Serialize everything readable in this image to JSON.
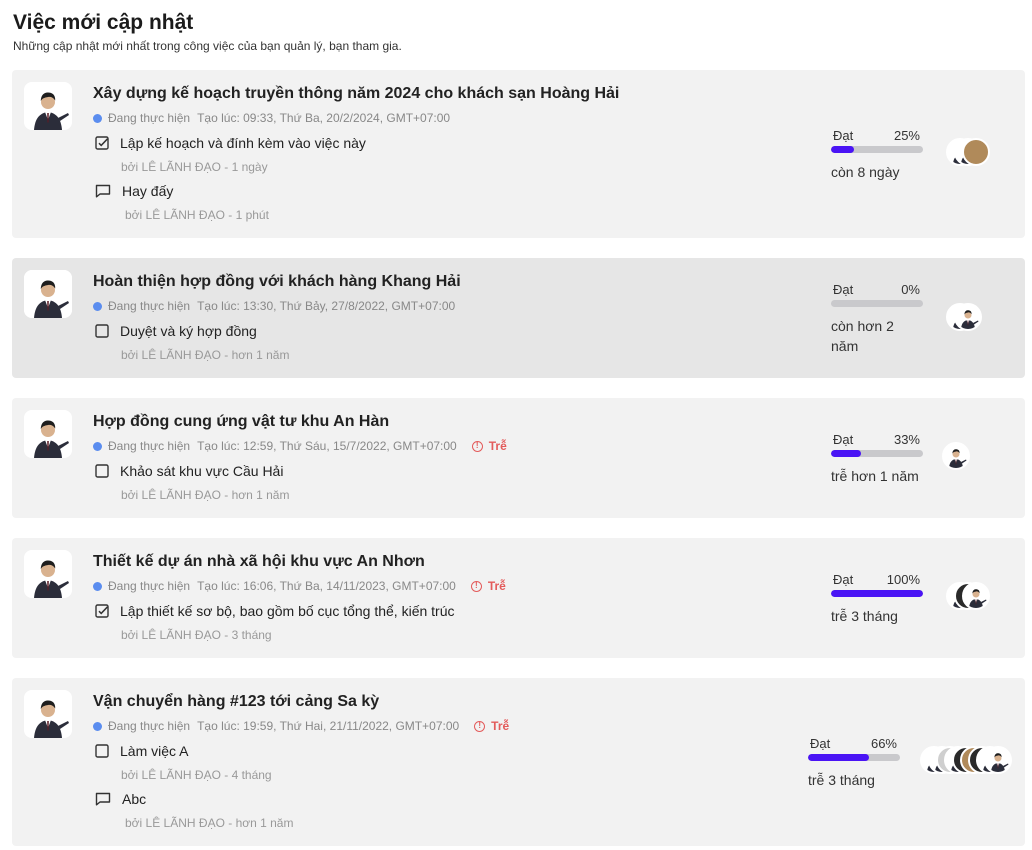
{
  "header": {
    "title": "Việc mới cập nhật",
    "subtitle": "Những cập nhật mới nhất trong công việc của bạn quản lý, bạn tham gia."
  },
  "colors": {
    "progress_fill": "#4a14f5",
    "status_dot": "#5b8def",
    "late": "#e35b5b"
  },
  "tasks": [
    {
      "title": "Xây dựng kế hoạch truyền thông năm 2024 cho khách sạn Hoàng Hải",
      "status": "Đang thực hiện",
      "created": "Tạo lúc: 09:33, Thứ Ba, 20/2/2024, GMT+07:00",
      "late": "",
      "updates": [
        {
          "icon": "checkbox-checked-icon",
          "text": "Lập kế hoạch và đính kèm vào việc này",
          "by": "bởi LÊ LÃNH ĐẠO - 1 ngày"
        },
        {
          "icon": "comment-icon",
          "text": "Hay đấy",
          "by": "bởi LÊ LÃNH ĐẠO - 1 phút"
        }
      ],
      "progress_label": "Đạt",
      "progress": 25,
      "progress_text": "25%",
      "remaining": "còn 8 ngày"
    },
    {
      "title": "Hoàn thiện hợp đồng với khách hàng Khang Hải",
      "status": "Đang thực hiện",
      "created": "Tạo lúc: 13:30, Thứ Bảy, 27/8/2022, GMT+07:00",
      "late": "",
      "updates": [
        {
          "icon": "checkbox-icon",
          "text": "Duyệt và ký hợp đồng",
          "by": "bởi LÊ LÃNH ĐẠO - hơn 1 năm"
        }
      ],
      "progress_label": "Đạt",
      "progress": 0,
      "progress_text": "0%",
      "remaining": "còn hơn 2 năm"
    },
    {
      "title": "Hợp đồng cung ứng vật tư khu An Hàn",
      "status": "Đang thực hiện",
      "created": "Tạo lúc: 12:59, Thứ Sáu, 15/7/2022, GMT+07:00",
      "late": "Trễ",
      "updates": [
        {
          "icon": "checkbox-icon",
          "text": "Khảo sát khu vực Cầu Hải",
          "by": "bởi LÊ LÃNH ĐẠO - hơn 1 năm"
        }
      ],
      "progress_label": "Đạt",
      "progress": 33,
      "progress_text": "33%",
      "remaining": "trễ hơn 1 năm"
    },
    {
      "title": "Thiết kế dự án nhà xã hội khu vực An Nhơn",
      "status": "Đang thực hiện",
      "created": "Tạo lúc: 16:06, Thứ Ba, 14/11/2023, GMT+07:00",
      "late": "Trễ",
      "updates": [
        {
          "icon": "checkbox-checked-icon",
          "text": "Lập thiết kế sơ bộ, bao gồm bố cục tổng thể, kiến trúc",
          "by": "bởi LÊ LÃNH ĐẠO - 3 tháng"
        }
      ],
      "progress_label": "Đạt",
      "progress": 100,
      "progress_text": "100%",
      "remaining": "trễ 3 tháng"
    },
    {
      "title": "Vận chuyển hàng #123 tới cảng Sa kỳ",
      "status": "Đang thực hiện",
      "created": "Tạo lúc: 19:59, Thứ Hai, 21/11/2022, GMT+07:00",
      "late": "Trễ",
      "updates": [
        {
          "icon": "checkbox-icon",
          "text": "Làm việc A",
          "by": "bởi LÊ LÃNH ĐẠO - 4 tháng"
        },
        {
          "icon": "comment-icon",
          "text": "Abc",
          "by": "bởi LÊ LÃNH ĐẠO - hơn 1 năm"
        }
      ],
      "progress_label": "Đạt",
      "progress": 66,
      "progress_text": "66%",
      "remaining": "trễ 3 tháng"
    }
  ]
}
